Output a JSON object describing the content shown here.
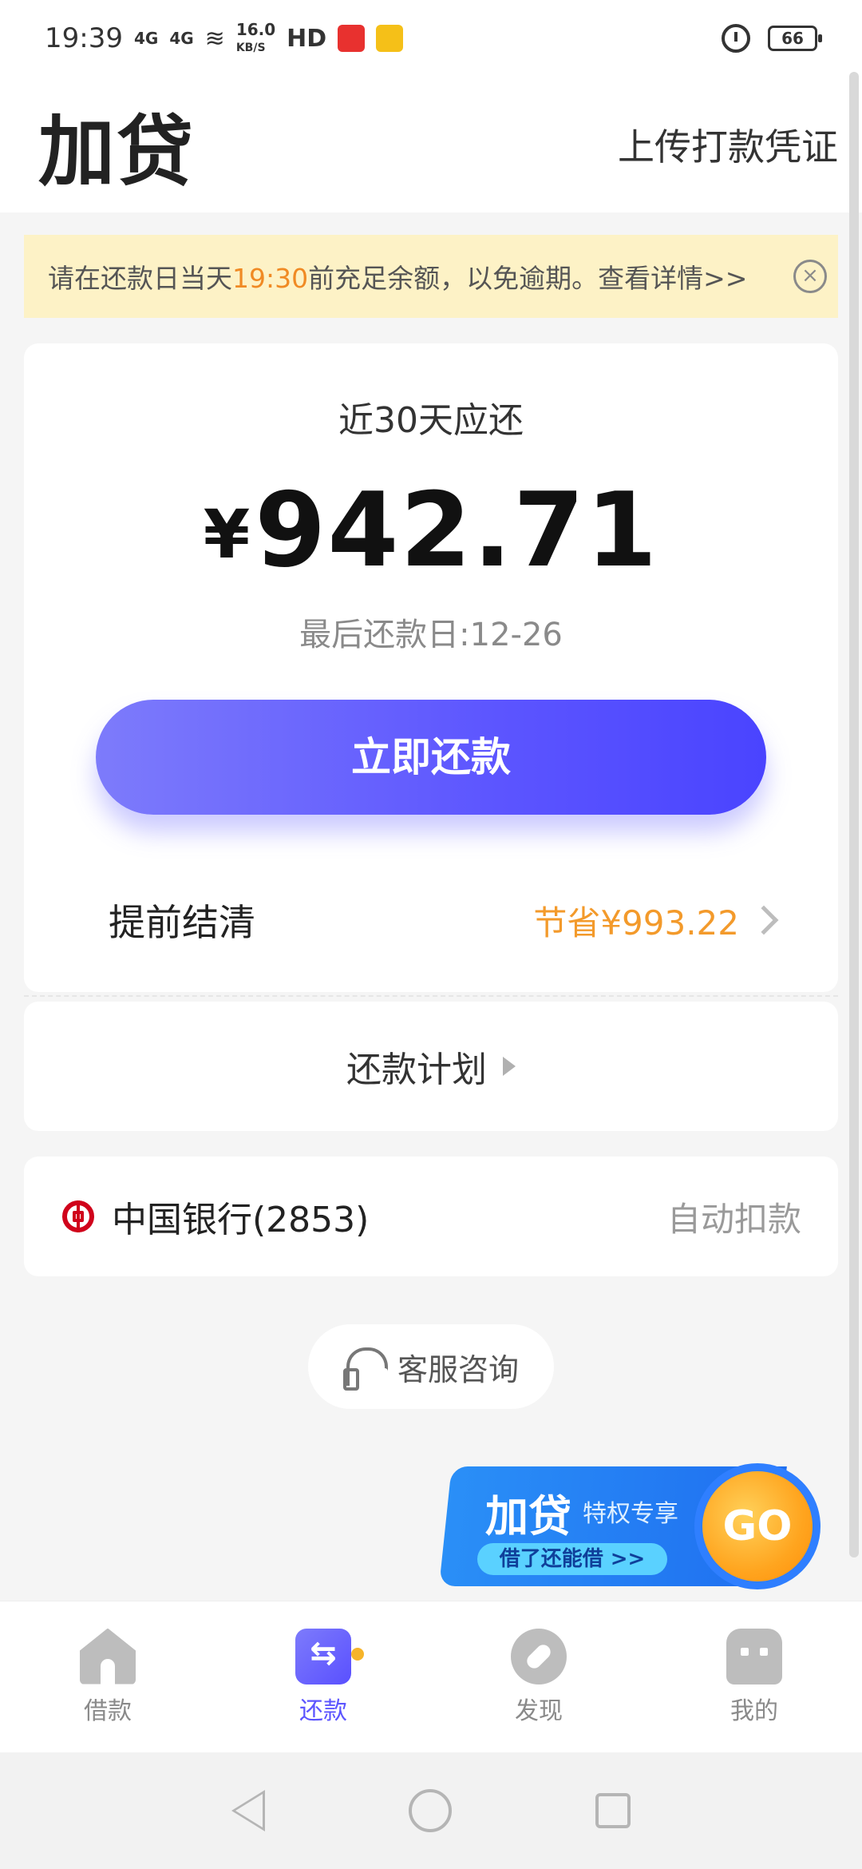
{
  "status_bar": {
    "time": "19:39",
    "net1": "4G",
    "net2": "4G",
    "speed": "16.0",
    "speed_unit": "KB/S",
    "hd": "HD",
    "battery": "66"
  },
  "header": {
    "title": "加贷",
    "upload_label": "上传打款凭证"
  },
  "notice": {
    "prefix": "请在还款日当天",
    "time": "19:30",
    "suffix": "前充足余额，以免逾期。查看详情>>"
  },
  "due": {
    "label": "近30天应还",
    "currency": "¥",
    "amount": "942.71",
    "last_day": "最后还款日:12-26",
    "repay_button": "立即还款",
    "settle_label": "提前结清",
    "settle_save": "节省¥993.22"
  },
  "plan": {
    "label": "还款计划"
  },
  "bank": {
    "name": "中国银行(2853)",
    "auto_debit": "自动扣款"
  },
  "service": {
    "label": "客服咨询"
  },
  "promo": {
    "title": "加贷",
    "subtitle": "特权专享",
    "tag": "借了还能借 >>",
    "go": "GO"
  },
  "bottom_nav": {
    "items": [
      {
        "label": "借款",
        "icon": "home-icon",
        "active": false
      },
      {
        "label": "还款",
        "icon": "repay-icon",
        "active": true
      },
      {
        "label": "发现",
        "icon": "discover-icon",
        "active": false
      },
      {
        "label": "我的",
        "icon": "profile-icon",
        "active": false
      }
    ]
  },
  "colors": {
    "accent": "#5c55ff",
    "orange": "#f39a2b",
    "notice_bg": "#fdf2c6"
  }
}
